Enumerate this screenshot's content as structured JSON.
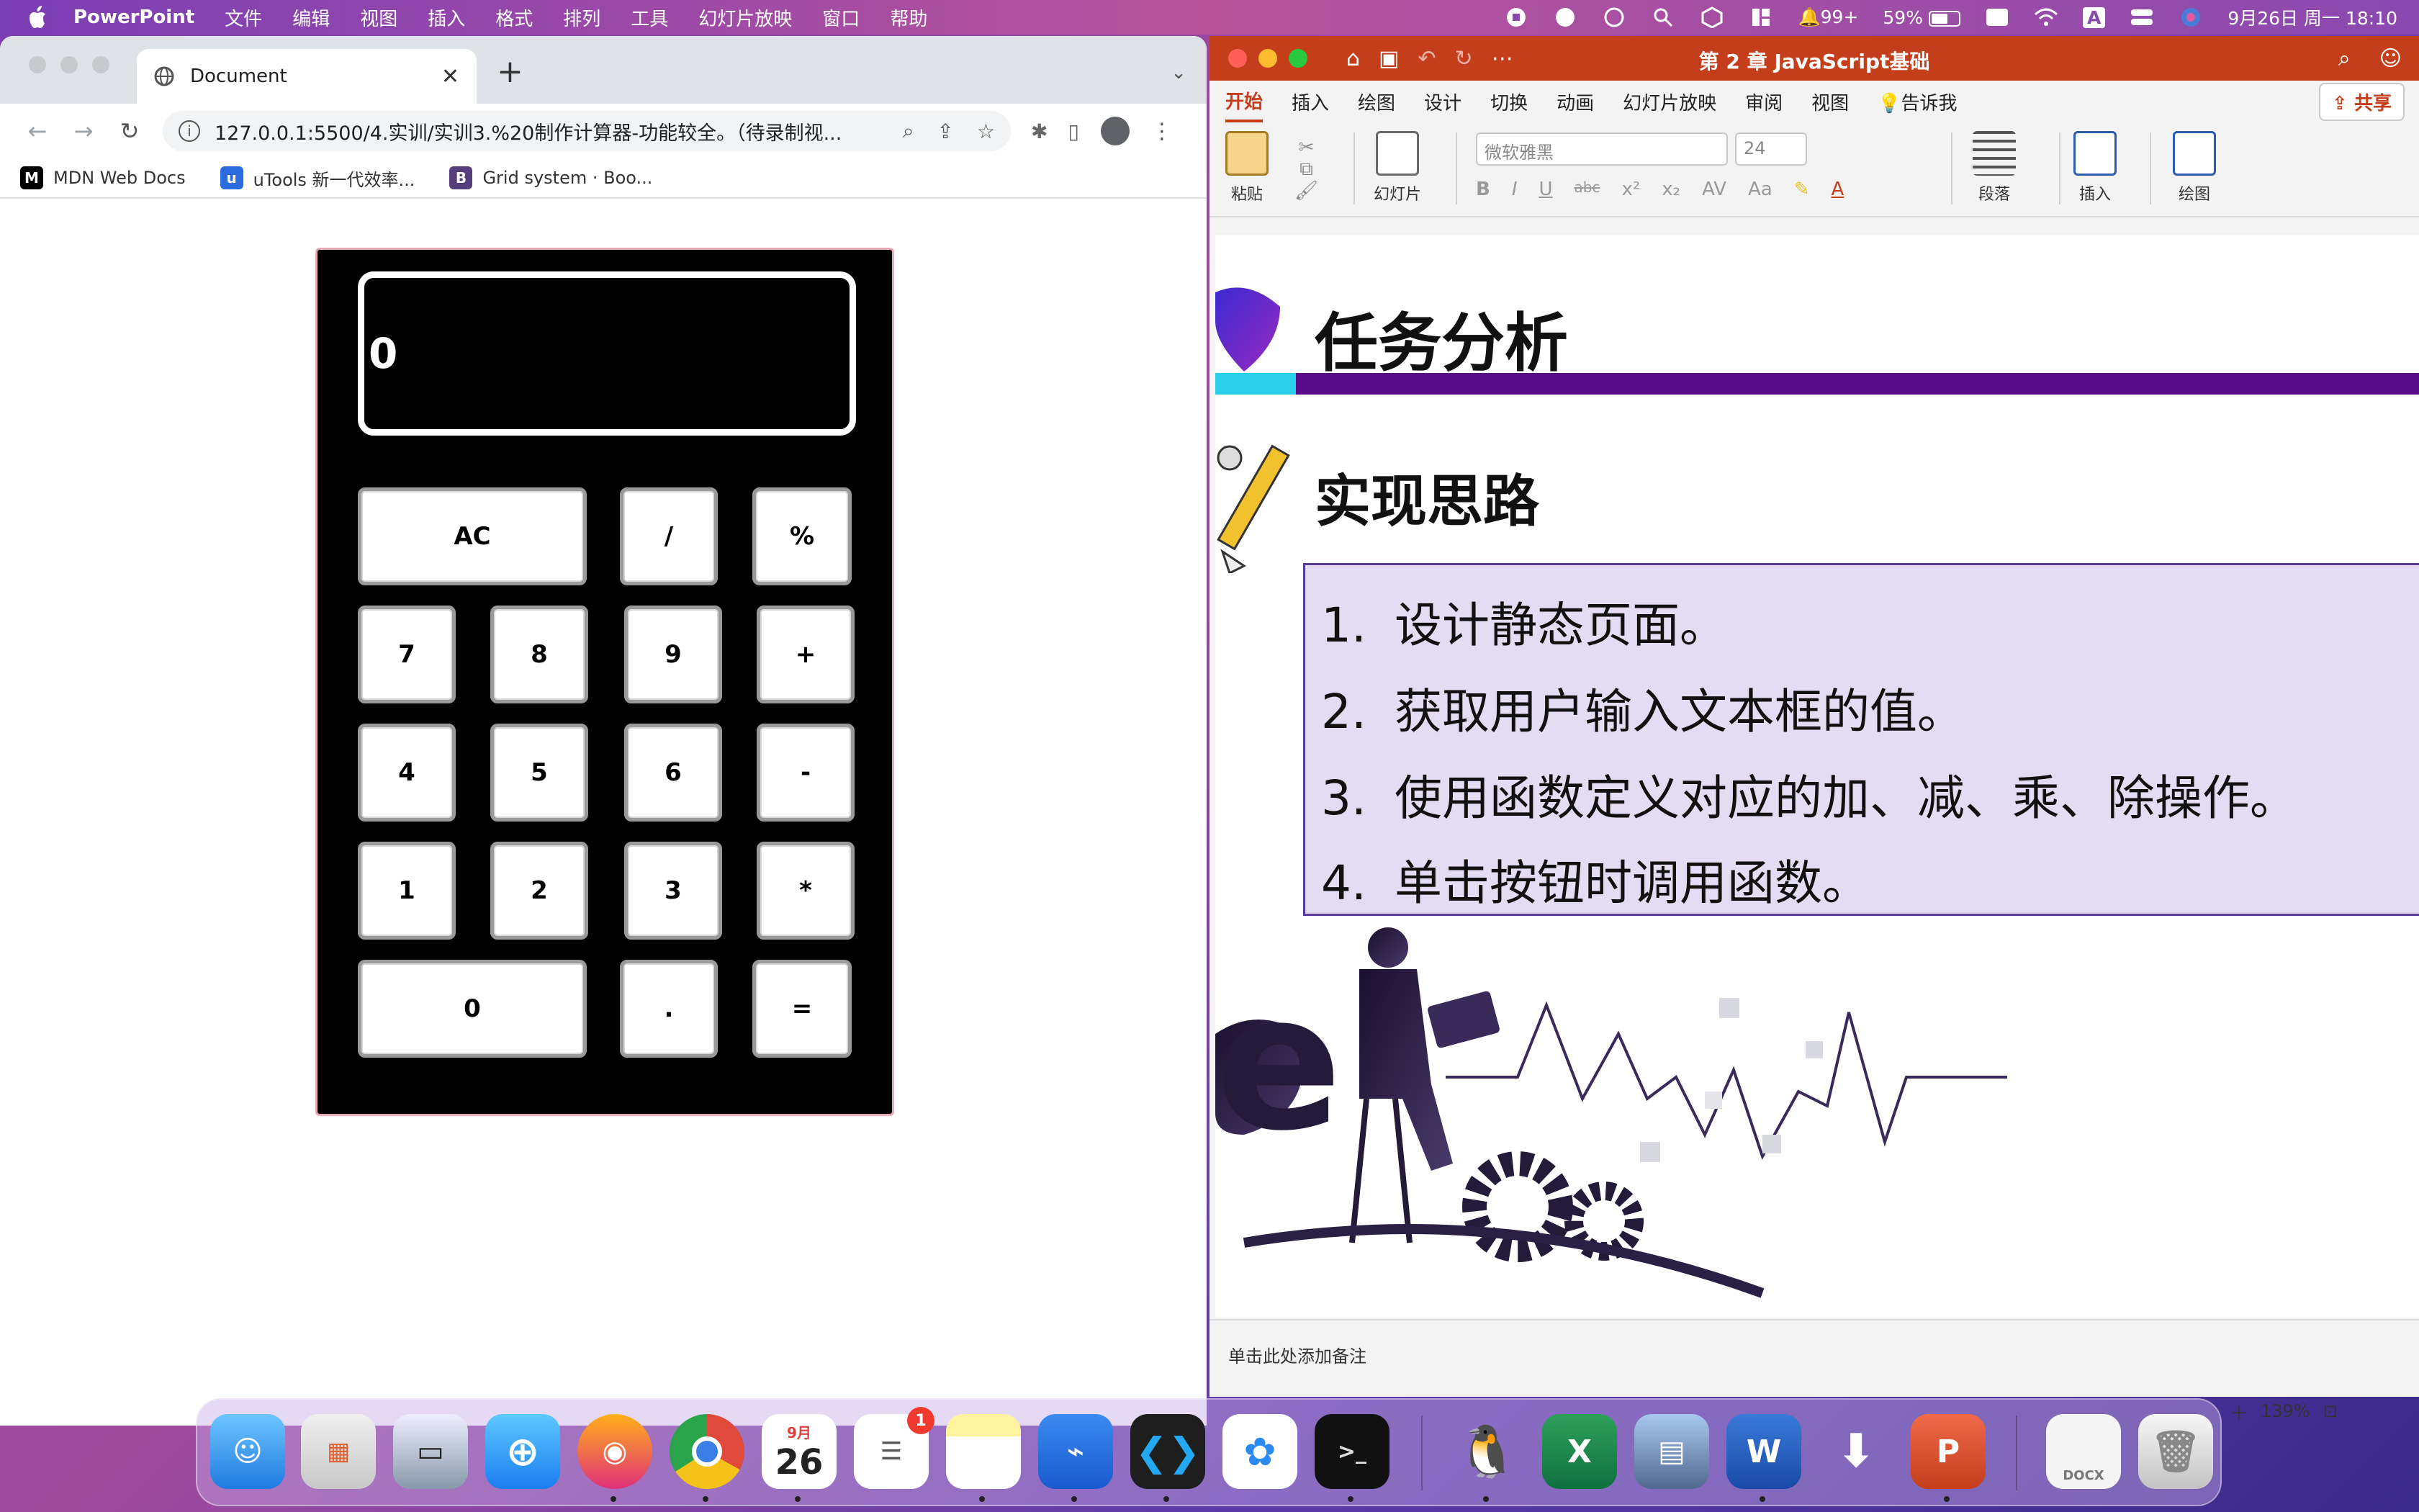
{
  "menubar": {
    "app_name": "PowerPoint",
    "items": [
      "文件",
      "编辑",
      "视图",
      "插入",
      "格式",
      "排列",
      "工具",
      "幻灯片放映",
      "窗口",
      "帮助"
    ],
    "notification_count": "99+",
    "battery": "59%",
    "input_method": "A",
    "datetime": "9月26日 周一  18:10"
  },
  "browser": {
    "tab_title": "Document",
    "new_tab": "+",
    "address": "127.0.0.1:5500/4.实训/实训3.%20制作计算器-功能较全。（待录制视...",
    "bookmarks": [
      {
        "label": "MDN Web Docs",
        "icon": "M"
      },
      {
        "label": "uTools 新一代效率...",
        "icon": "u"
      },
      {
        "label": "Grid system · Boo...",
        "icon": "B"
      }
    ]
  },
  "calculator": {
    "display": "0",
    "keys": {
      "ac": "AC",
      "divide": "/",
      "percent": "%",
      "k7": "7",
      "k8": "8",
      "k9": "9",
      "plus": "+",
      "k4": "4",
      "k5": "5",
      "k6": "6",
      "minus": "-",
      "k1": "1",
      "k2": "2",
      "k3": "3",
      "multiply": "*",
      "k0": "0",
      "dot": ".",
      "equals": "="
    }
  },
  "powerpoint": {
    "doc_title": "第 2 章 JavaScript基础",
    "tabs": [
      "开始",
      "插入",
      "绘图",
      "设计",
      "切换",
      "动画",
      "幻灯片放映",
      "审阅",
      "视图"
    ],
    "tell_me": "告诉我",
    "share": "共享",
    "ribbon": {
      "paste": "粘贴",
      "slides": "幻灯片",
      "font_name": "微软雅黑",
      "font_size": "24",
      "paragraph": "段落",
      "insert": "插入",
      "draw": "绘图",
      "format_buttons": [
        "B",
        "I",
        "U",
        "abc",
        "x²",
        "x₂",
        "AV",
        "Aa"
      ]
    },
    "slide": {
      "heading": "任务分析",
      "subheading": "实现思路",
      "steps": [
        {
          "num": "1.",
          "text": "设计静态页面。"
        },
        {
          "num": "2.",
          "text": "获取用户输入文本框的值。"
        },
        {
          "num": "3.",
          "text": "使用函数定义对应的加、减、乘、除操作。"
        },
        {
          "num": "4.",
          "text": "单击按钮时调用函数。"
        }
      ]
    },
    "notes_placeholder": "单击此处添加备注",
    "zoom": "139%"
  },
  "dock": {
    "calendar_month": "9月",
    "calendar_day": "26",
    "reminders_badge": "1",
    "docx_label": "DOCX"
  },
  "colors": {
    "ppt_red": "#c43e1c",
    "slide_purple": "#5a0d8a",
    "slide_cyan": "#2ad0ea",
    "list_bg": "#e4dcf2"
  }
}
